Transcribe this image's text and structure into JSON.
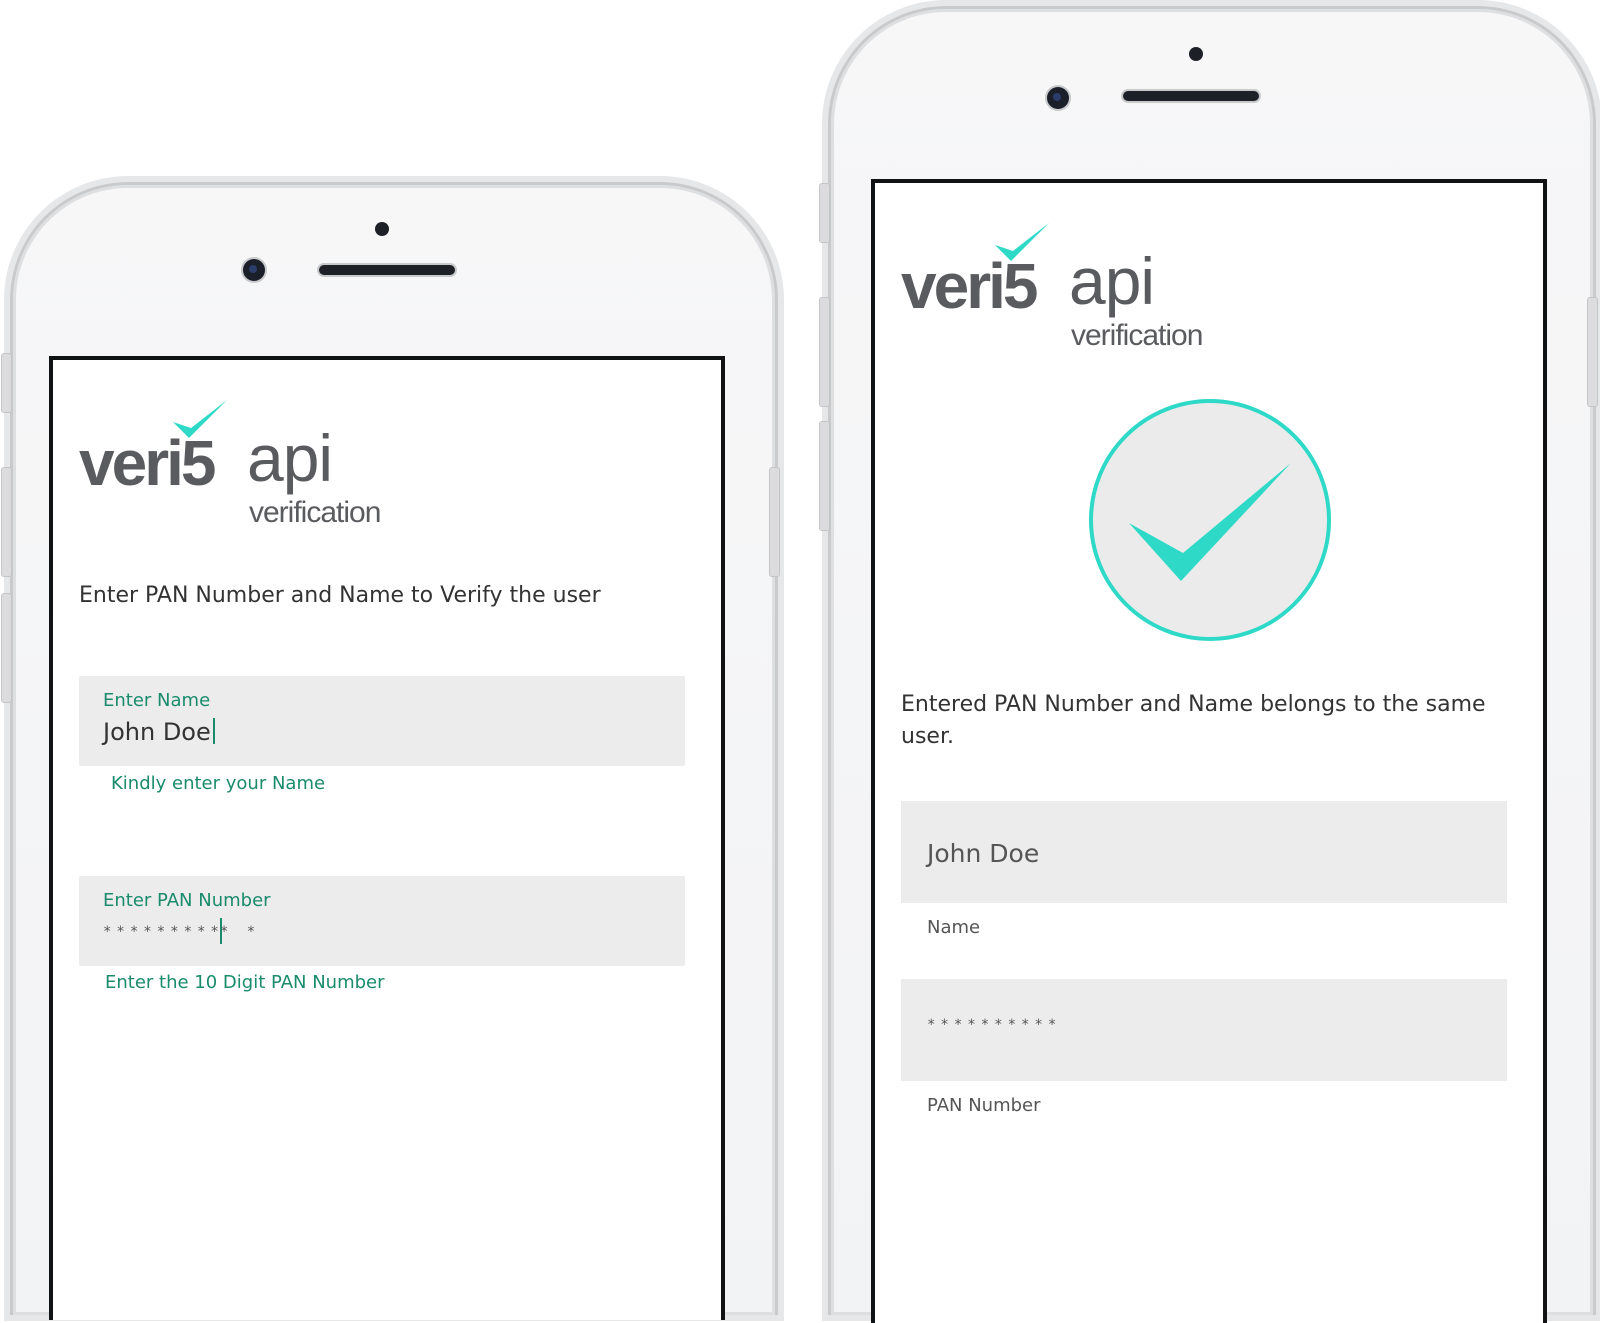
{
  "brand": {
    "word": "veri5",
    "api": "api",
    "subtitle": "verification",
    "accent": "#2fd9c8",
    "text_color": "#5a5b5e"
  },
  "form_screen": {
    "instruction": "Enter PAN Number and Name to Verify the user",
    "name_field": {
      "label": "Enter Name",
      "value": "John Doe",
      "hint": "Kindly enter your Name"
    },
    "pan_field": {
      "label": "Enter PAN Number",
      "mask_before_caret": "*********",
      "mask_after_caret": "* *",
      "hint": "Enter the 10 Digit PAN Number"
    }
  },
  "result_screen": {
    "status_icon": "check-circle-icon",
    "message": "Entered PAN Number and Name belongs to the same user.",
    "name_value": "John Doe",
    "name_caption": "Name",
    "pan_value": "**********",
    "pan_caption": "PAN Number"
  },
  "colors": {
    "hint_green": "#1a8b6c",
    "field_bg": "#ececec",
    "success_teal": "#2fd9c8"
  }
}
